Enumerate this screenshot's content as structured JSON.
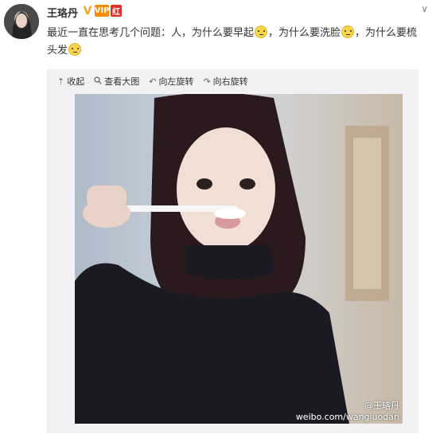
{
  "user": {
    "name": "王珞丹",
    "badges": [
      "V",
      "VIP",
      "红"
    ]
  },
  "post": {
    "text_parts": [
      "最近一直在思考几个问题：人，为什么要早起",
      "，为什么要洗脸",
      "，为什么要梳头发"
    ]
  },
  "toolbar": {
    "collapse": "收起",
    "view_large": "查看大图",
    "rotate_left": "向左旋转",
    "rotate_right": "向右旋转"
  },
  "image": {
    "watermark_handle": "@王珞丹",
    "watermark_url": "weibo.com/wangluodan"
  },
  "icons": {
    "more": "chevron-down-icon",
    "collapse": "arrow-up-icon",
    "view_large": "magnifier-icon",
    "rotate_left": "rotate-left-icon",
    "rotate_right": "rotate-right-icon",
    "emoji": "awkward-smile-emoji"
  },
  "colors": {
    "username": "#333333",
    "vip_badge": "#ff8c00",
    "verified": "#f5a623",
    "card_bg": "#f2f2f5"
  }
}
